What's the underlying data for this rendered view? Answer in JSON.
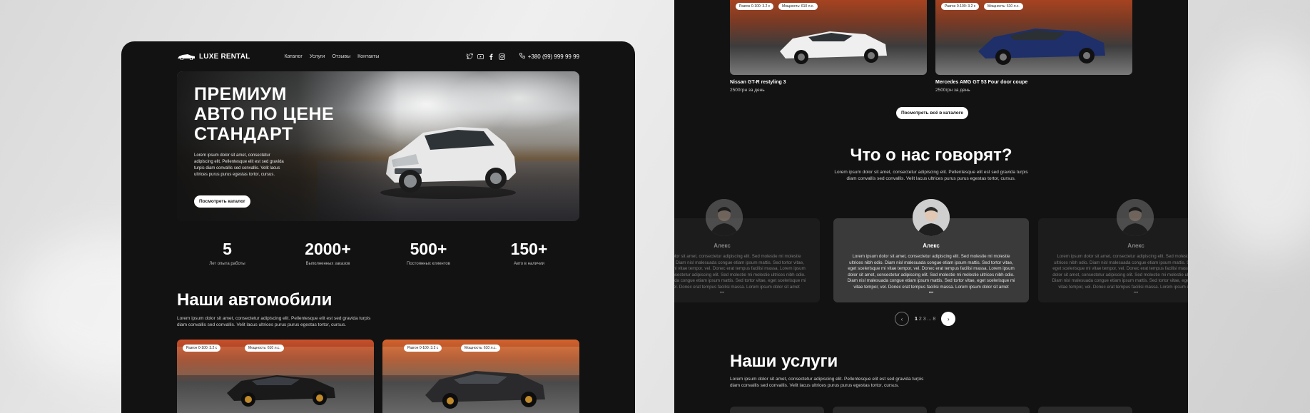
{
  "brand": {
    "name": "LUXE RENTAL"
  },
  "nav": {
    "links": [
      "Каталог",
      "Услуги",
      "Отзывы",
      "Контакты"
    ],
    "phone": "+380 (99) 999 99 99",
    "socials": [
      "twitter-icon",
      "youtube-icon",
      "facebook-icon",
      "instagram-icon"
    ]
  },
  "hero": {
    "title_line1": "ПРЕМИУМ",
    "title_line2": "АВТО ПО ЦЕНЕ",
    "title_line3": "СТАНДАРТ",
    "text": "Lorem ipsum dolor sit amet, consectetur adipiscing elit. Pellentesque elit est sed gravida turpis diam convallis sed convallis. Velit lacus ultrices purus purus egestas tortor, cursus.",
    "cta": "Посмотреть каталог"
  },
  "stats": [
    {
      "value": "5",
      "label": "Лет опыта работы"
    },
    {
      "value": "2000+",
      "label": "Выполненных заказов"
    },
    {
      "value": "500+",
      "label": "Постоянных клиентов"
    },
    {
      "value": "150+",
      "label": "Авто в наличии"
    }
  ],
  "cars_section": {
    "title": "Наши автомобили",
    "subtitle_l1": "Lorem ipsum dolor sit amet, consectetur adipiscing elit. Pellentesque elit est sed gravida turpis",
    "subtitle_l2": "diam convallis sed convallis. Velit lacus ultrices purus purus egestas tortor, cursus.",
    "chip_accel": "Разгон 0-100: 3.2 с",
    "chip_power": "Мощность: 610 л.с.",
    "chip_accel_b": "Разгон 0-100: 3.2 с",
    "chip_power_b": "Мощность: 610 л.с."
  },
  "catalog": {
    "car1": {
      "name": "Nissan GT-R restyling 3",
      "price": "2500грн за день"
    },
    "car2": {
      "name": "Mercedes AMG GT 53 Four door coupe",
      "price": "2500грн за день"
    },
    "chip_accel": "Разгон 0-100: 3.2 с",
    "chip_power": "Мощность: 610 л.с.",
    "all_button": "Посмотреть всё в каталоге"
  },
  "reviews": {
    "title": "Что о нас говорят?",
    "subtitle_l1": "Lorem ipsum dolor sit amet, consectetur adipiscing elit. Pellentesque elit est sed gravida turpis",
    "subtitle_l2": "diam convallis sed convallis. Velit lacus ultrices purus purus egestas tortor, cursus.",
    "name": "Алекс",
    "text": "Lorem ipsum dolor sit amet, consectetur adipiscing elit. Sed molestie mi molestie ultrices nibh odio. Diam nisl malesuada congue etiam ipsum mattis. Sed tortor vitae, eget scelerisque mi vitae tempor, vel. Donec erat tempus facilisi massa. Lorem ipsum dolor sit amet, consectetur adipiscing elit. Sed molestie mi molestie ultrices nibh odio. Diam nisl malesuada congue etiam ipsum mattis. Sed tortor vitae, eget scelerisque mi vitae tempor, vel. Donec erat tempus facilisi massa. Lorem ipsum dolor sit amet",
    "more": "•••",
    "pager": {
      "p1": "1",
      "p2": "2",
      "p3": "3",
      "dots": "...",
      "last": "8"
    }
  },
  "services": {
    "title": "Наши услуги",
    "subtitle_l1": "Lorem ipsum dolor sit amet, consectetur adipiscing elit. Pellentesque elit est sed gravida turpis",
    "subtitle_l2": "diam convallis sed convallis. Velit lacus ultrices purus purus egestas tortor, cursus."
  }
}
